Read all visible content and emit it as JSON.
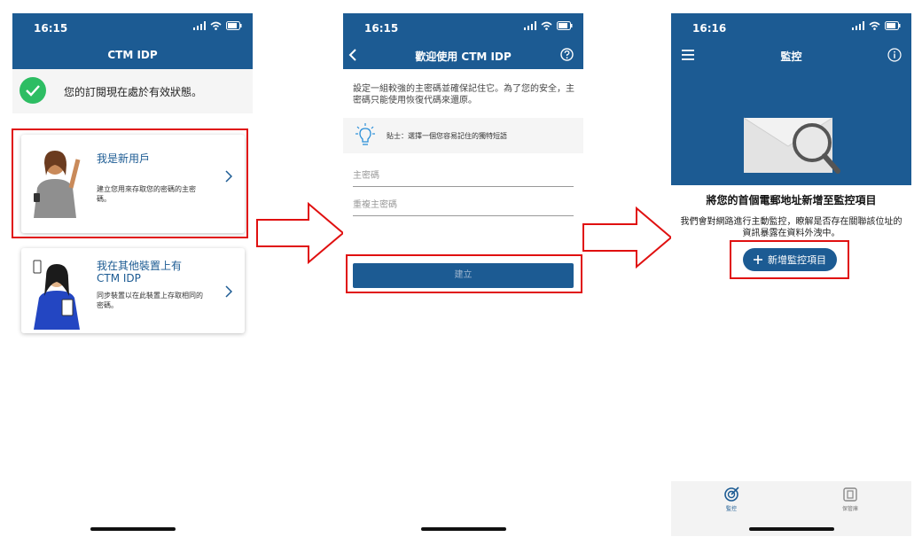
{
  "screens": [
    {
      "status_time": "16:15",
      "nav_title": "CTM IDP",
      "subscription_text": "您的訂閱現在處於有效狀態。",
      "options": [
        {
          "title": "我是新用戶",
          "description": "建立您用來存取您的密碼的主密碼。"
        },
        {
          "title_line1": "我在其他裝置上有",
          "title_line2": "CTM IDP",
          "description": "同步裝置以在此裝置上存取相同的密碼。"
        }
      ]
    },
    {
      "status_time": "16:15",
      "nav_title": "歡迎使用 CTM IDP",
      "intro_text": "設定一組較強的主密碼並確保記住它。為了您的安全，主密碼只能使用恢復代碼來還原。",
      "tip_text": "貼士：選擇一個您容易記住的獨特短語",
      "fields": [
        "主密碼",
        "重複主密碼"
      ],
      "create_label": "建立"
    },
    {
      "status_time": "16:16",
      "nav_title": "監控",
      "heading": "將您的首個電郵地址新增至監控項目",
      "description": "我們會對網路進行主動監控，瞭解是否存在關聯該位址的資訊暴露在資料外洩中。",
      "add_label": "新增監控項目",
      "tabs": [
        "監控",
        "保管庫"
      ]
    }
  ],
  "colors": {
    "brand": "#1c5b93",
    "success": "#2dbd63",
    "highlight": "#e01010"
  },
  "icons": [
    "signal-icon",
    "wifi-icon",
    "battery-icon",
    "check-icon",
    "chevron-right-icon",
    "back-icon",
    "help-icon",
    "lightbulb-icon",
    "menu-icon",
    "info-icon",
    "envelope-search-icon",
    "plus-icon",
    "monitor-tab-icon",
    "vault-tab-icon"
  ]
}
